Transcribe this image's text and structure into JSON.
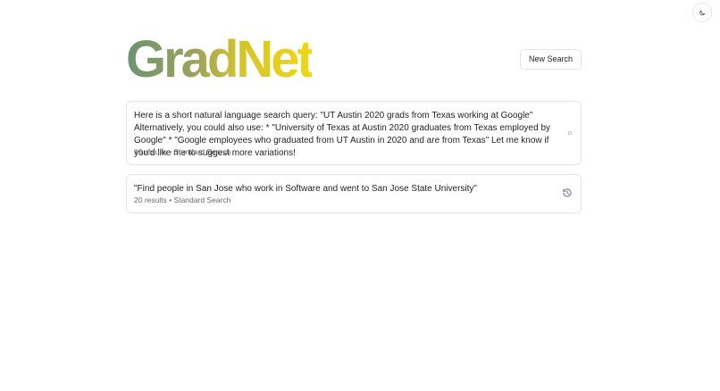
{
  "header": {
    "logo_text": "GradNet",
    "new_search_label": "New Search"
  },
  "theme_toggle": {
    "icon": "moon-icon"
  },
  "history": [
    {
      "query": "Here is a short natural language search query: \"UT Austin 2020 grads from Texas working at Google\" Alternatively, you could also use: * \"University of Texas at Austin 2020 graduates from Texas employed by Google\" * \"Google employees who graduated from UT Austin in 2020 and are from Texas\" Let me know if you'd like me to suggest more variations!",
      "meta": "10 results • Standard Search",
      "icon": "loading-dot-icon"
    },
    {
      "query": "\"Find people in San Jose who work in Software and went to San Jose State University\"",
      "meta": "20 results • Standard Search",
      "icon": "history-icon"
    }
  ]
}
